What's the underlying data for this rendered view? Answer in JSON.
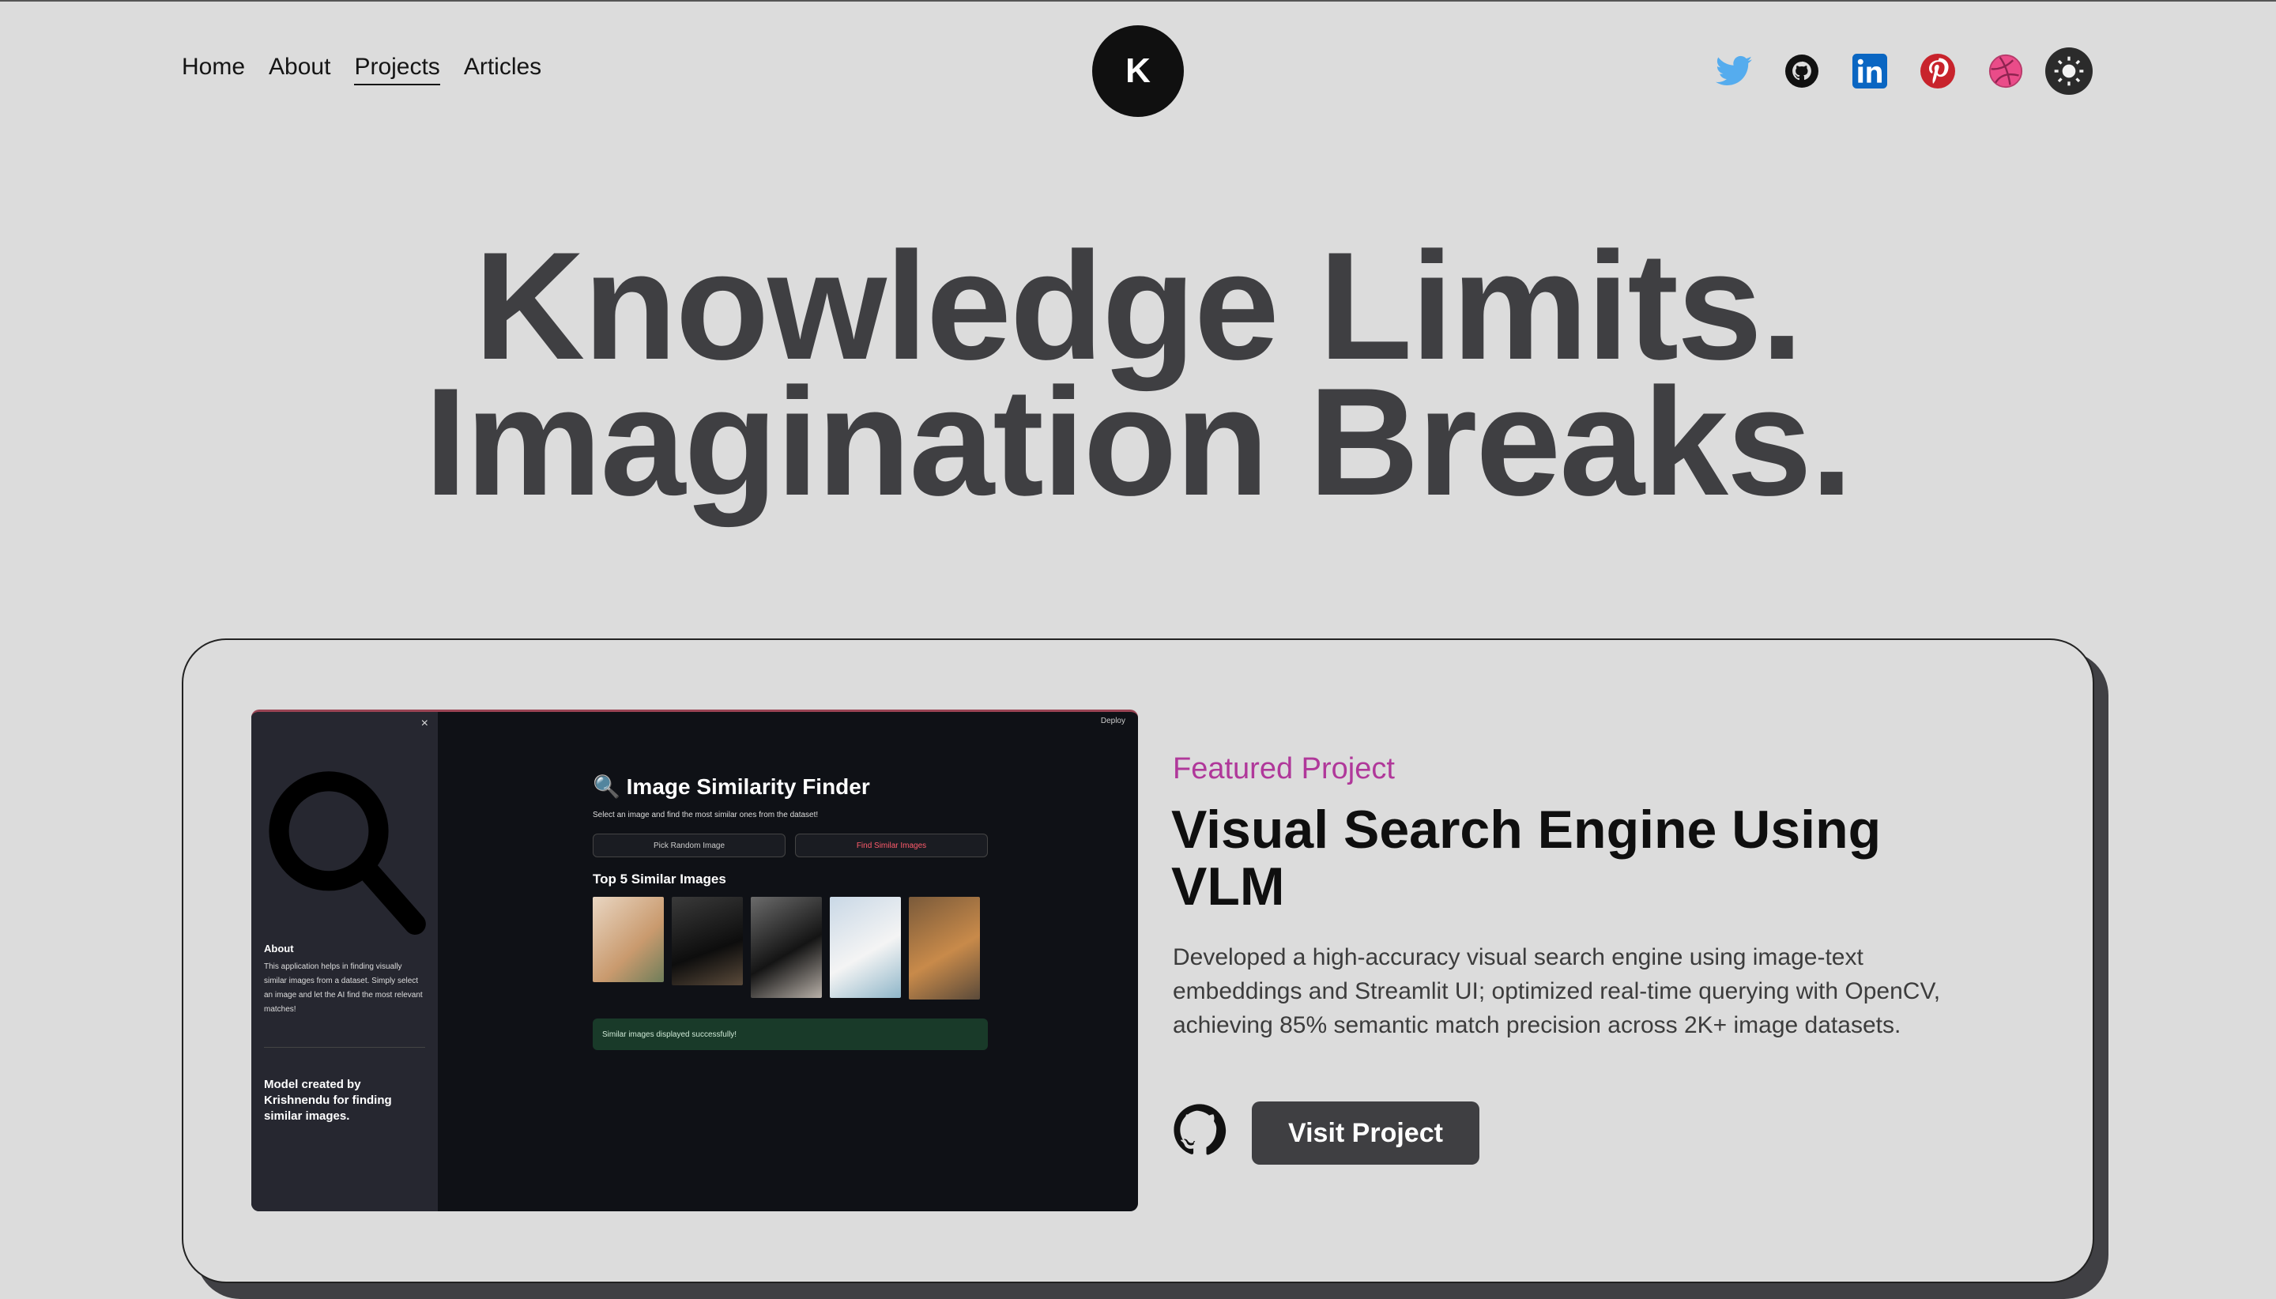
{
  "nav": {
    "items": [
      "Home",
      "About",
      "Projects",
      "Articles"
    ],
    "active": "Projects"
  },
  "logo": {
    "initial": "K"
  },
  "social": {
    "icons": [
      "twitter-icon",
      "github-icon",
      "linkedin-icon",
      "pinterest-icon",
      "dribbble-icon",
      "theme-toggle-icon"
    ],
    "colors": {
      "twitter": "#55acee",
      "github": "#111111",
      "linkedin": "#0a66c2",
      "pinterest": "#c8232c",
      "dribbble": "#ea4c89"
    }
  },
  "hero": {
    "line1": "Knowledge Limits.",
    "line2": "Imagination Breaks."
  },
  "project": {
    "eyebrow": "Featured Project",
    "title": "Visual Search Engine Using VLM",
    "description": "Developed a high-accuracy visual search engine using image-text embeddings and Streamlit UI; optimized real-time querying with OpenCV, achieving 85% semantic match precision across 2K+ image datasets.",
    "button": "Visit Project",
    "screenshot": {
      "close": "×",
      "deploy": "Deploy",
      "title": "Image Similarity Finder",
      "subtitle": "Select an image and find the most similar ones from the dataset!",
      "btn_random": "Pick Random Image",
      "btn_find": "Find Similar Images",
      "top5": "Top 5 Similar Images",
      "success": "Similar images displayed successfully!",
      "about_heading": "About",
      "about_text": "This application helps in finding visually similar images from a dataset. Simply select an image and let the AI find the most relevant matches!",
      "model_text": "Model created by Krishnendu for finding similar images."
    }
  },
  "colors": {
    "accent": "#b0389a",
    "button_bg": "#3f3f42",
    "page_bg": "#dcdcdc"
  }
}
